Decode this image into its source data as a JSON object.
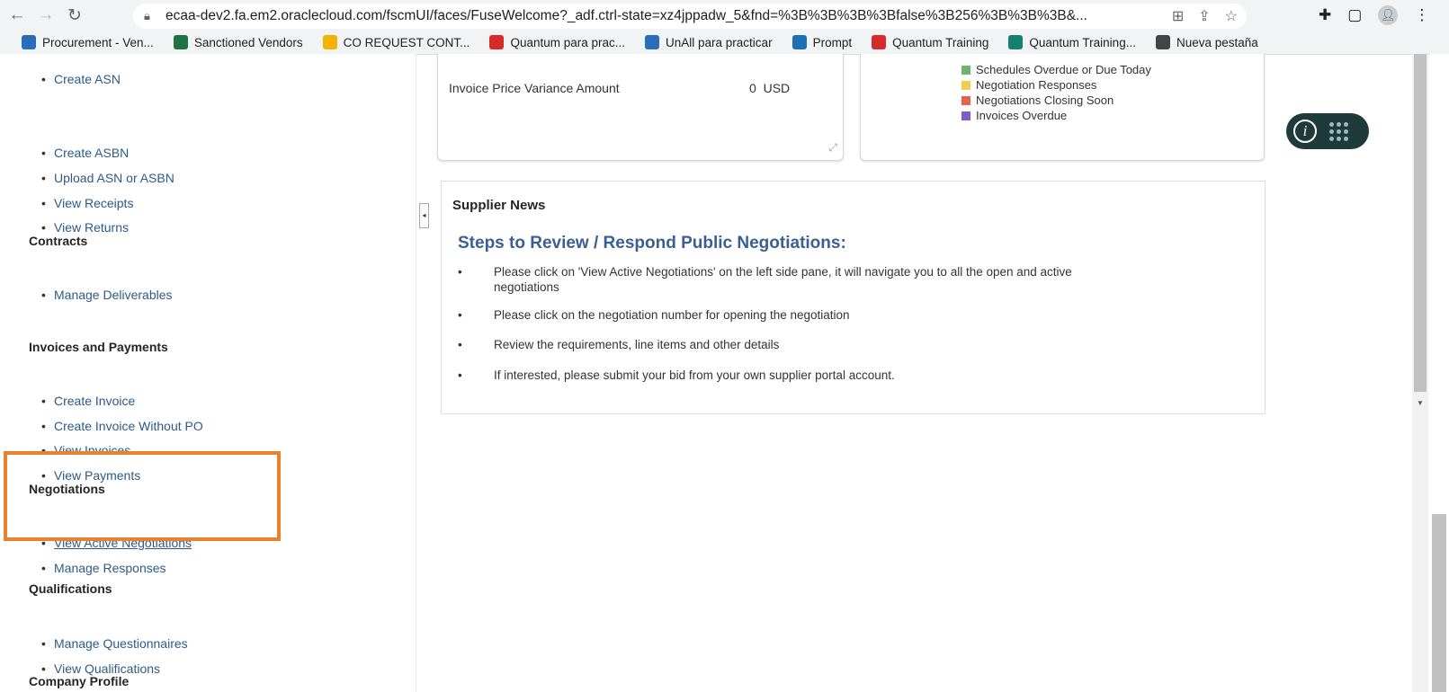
{
  "browser": {
    "url": "ecaa-dev2.fa.em2.oraclecloud.com/fscmUI/faces/FuseWelcome?_adf.ctrl-state=xz4jppadw_5&fnd=%3B%3B%3B%3Bfalse%3B256%3B%3B%3B&...",
    "bookmarks": [
      {
        "label": "Procurement - Ven...",
        "color": "#2a6ebb"
      },
      {
        "label": "Sanctioned Vendors",
        "color": "#1f7244"
      },
      {
        "label": "CO REQUEST CONT...",
        "color": "#f2b400"
      },
      {
        "label": "Quantum para prac...",
        "color": "#d62b2b"
      },
      {
        "label": "UnAll para practicar",
        "color": "#2a6ebb"
      },
      {
        "label": "Prompt",
        "color": "#1e6fb8"
      },
      {
        "label": "Quantum Training",
        "color": "#d62b2b"
      },
      {
        "label": "Quantum Training...",
        "color": "#138072"
      },
      {
        "label": "Nueva pestaña",
        "color": "#444444"
      }
    ]
  },
  "sidebar": {
    "sections": [
      {
        "title": "",
        "items": [
          "Create ASN",
          "Create ASBN",
          "Upload ASN or ASBN",
          "View Receipts",
          "View Returns"
        ]
      },
      {
        "title": "Contracts",
        "items": [
          "Manage Deliverables"
        ]
      },
      {
        "title": "Invoices and Payments",
        "items": [
          "Create Invoice",
          "Create Invoice Without PO",
          "View Invoices",
          "View Payments"
        ]
      },
      {
        "title": "Negotiations",
        "items": [
          "View Active Negotiations",
          "Manage Responses"
        ]
      },
      {
        "title": "Qualifications",
        "items": [
          "Manage Questionnaires",
          "View Qualifications"
        ]
      },
      {
        "title": "Company Profile",
        "items": []
      }
    ]
  },
  "summary_card": {
    "label": "Invoice Price Variance Amount",
    "value": "0",
    "currency": "USD"
  },
  "legend": {
    "items": [
      {
        "label": "Schedules Overdue or Due Today",
        "color": "#6db46d"
      },
      {
        "label": "Negotiation Responses",
        "color": "#f2cf4a"
      },
      {
        "label": "Negotiations Closing Soon",
        "color": "#e8624a"
      },
      {
        "label": "Invoices Overdue",
        "color": "#7b5fc7"
      }
    ]
  },
  "news": {
    "header": "Supplier News",
    "title": "Steps to Review / Respond Public Negotiations:",
    "items": [
      "Please click on 'View Active Negotiations' on the left side pane, it will navigate you to all the open and active negotiations",
      "Please click on the negotiation number for opening the negotiation",
      "Review the requirements, line items and other details",
      "If interested, please submit your bid from your own supplier portal account."
    ]
  },
  "colors": {
    "highlight": "#e8822f",
    "link": "#2e5a88",
    "news_title": "#3a5f95"
  }
}
